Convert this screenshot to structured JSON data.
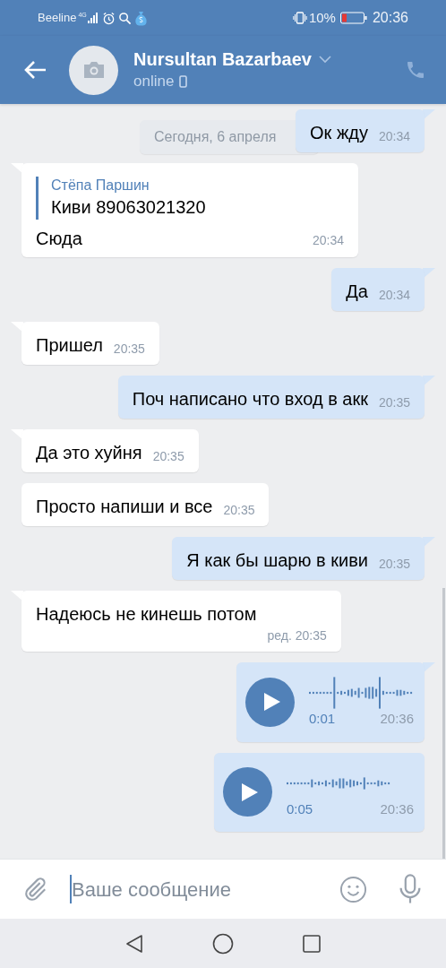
{
  "status_bar": {
    "carrier": "Beeline",
    "network": "4G",
    "battery": "10%",
    "time": "20:36"
  },
  "header": {
    "name": "Nursultan Bazarbaev",
    "status": "online"
  },
  "date_separator": "Сегодня, 6 апреля",
  "messages": [
    {
      "kind": "text",
      "outgoing": true,
      "tail": true,
      "text": "Ок жду",
      "time": "20:34"
    },
    {
      "kind": "reply",
      "outgoing": false,
      "tail": true,
      "reply": {
        "author": "Стёпа Паршин",
        "text": "Киви 89063021320"
      },
      "text": "Сюда",
      "time": "20:34"
    },
    {
      "kind": "text",
      "outgoing": true,
      "tail": true,
      "text": "Да",
      "time": "20:34"
    },
    {
      "kind": "text",
      "outgoing": false,
      "tail": true,
      "text": "Пришел",
      "time": "20:35"
    },
    {
      "kind": "text",
      "outgoing": true,
      "tail": true,
      "text": "Поч написано что вход в акк",
      "time": "20:35"
    },
    {
      "kind": "text",
      "outgoing": false,
      "tail": true,
      "text": "Да это хуйня",
      "time": "20:35"
    },
    {
      "kind": "text",
      "outgoing": false,
      "tail": false,
      "text": "Просто напиши и все",
      "time": "20:35"
    },
    {
      "kind": "text",
      "outgoing": true,
      "tail": true,
      "text": "Я как бы шарю в киви",
      "time": "20:35"
    },
    {
      "kind": "text",
      "outgoing": false,
      "tail": true,
      "text": "Надеюсь не кинешь потом",
      "time": "20:35",
      "edited_label": "ред."
    },
    {
      "kind": "voice",
      "outgoing": true,
      "tail": true,
      "duration": "0:01",
      "time": "20:36"
    },
    {
      "kind": "voice",
      "outgoing": true,
      "tail": false,
      "duration": "0:05",
      "time": "20:36"
    }
  ],
  "composer": {
    "placeholder": "Ваше сообщение"
  }
}
